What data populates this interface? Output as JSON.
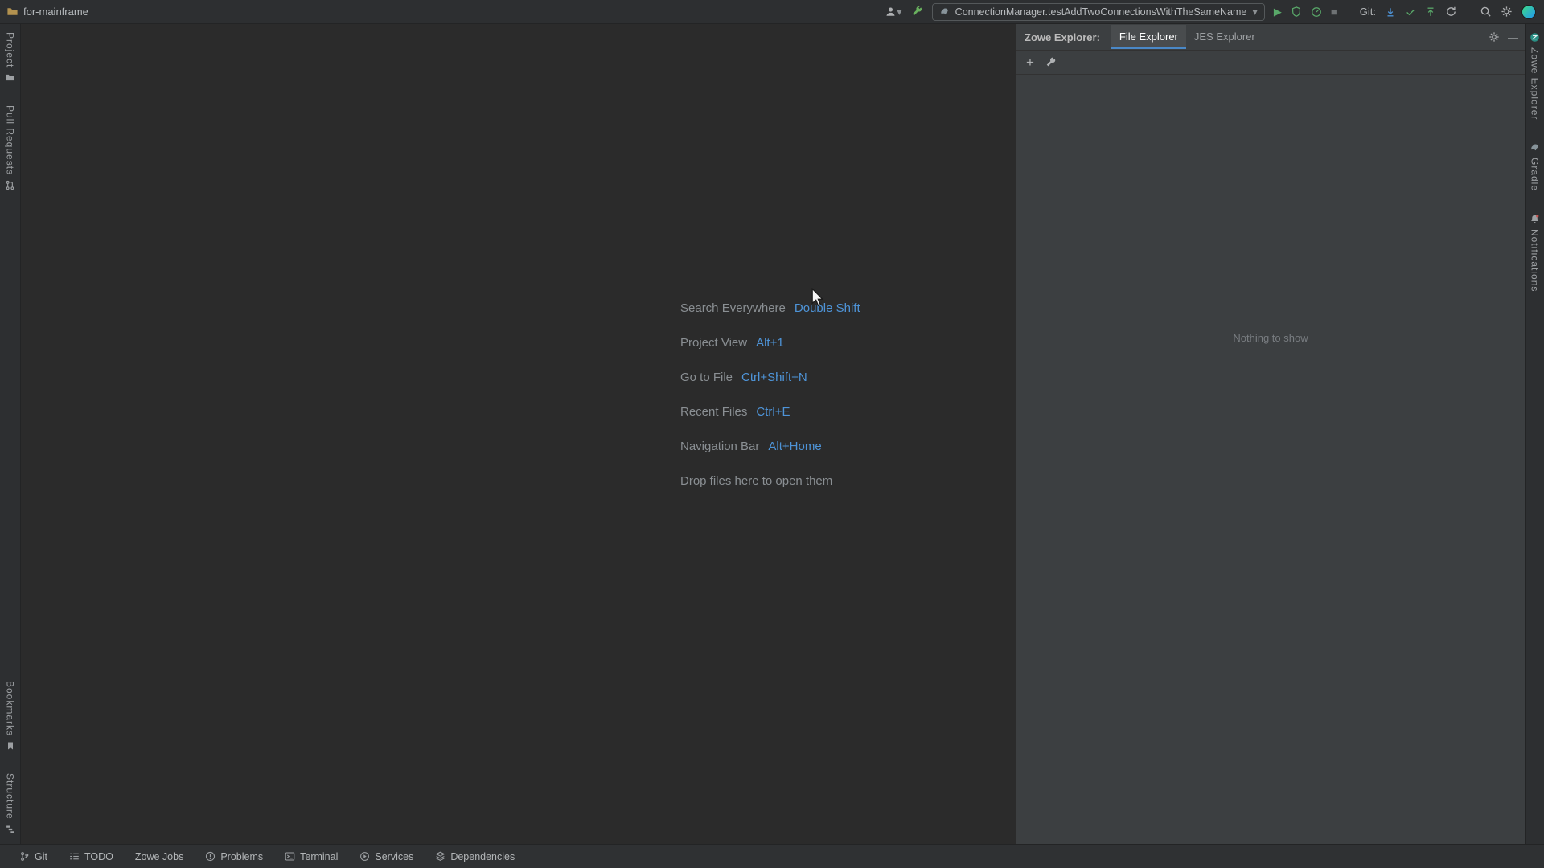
{
  "titlebar": {
    "project": "for-mainframe",
    "run_config": "ConnectionManager.testAddTwoConnectionsWithTheSameName",
    "git_label": "Git:"
  },
  "left_stripe": {
    "project": "Project",
    "pull_requests": "Pull Requests",
    "bookmarks": "Bookmarks",
    "structure": "Structure"
  },
  "editor": {
    "shortcuts": [
      {
        "label": "Search Everywhere",
        "keys": "Double Shift"
      },
      {
        "label": "Project View",
        "keys": "Alt+1"
      },
      {
        "label": "Go to File",
        "keys": "Ctrl+Shift+N"
      },
      {
        "label": "Recent Files",
        "keys": "Ctrl+E"
      },
      {
        "label": "Navigation Bar",
        "keys": "Alt+Home"
      }
    ],
    "drop_hint": "Drop files here to open them"
  },
  "zowe": {
    "title": "Zowe Explorer:",
    "tab_file": "File Explorer",
    "tab_jes": "JES Explorer",
    "empty": "Nothing to show"
  },
  "right_stripe": {
    "zowe": "Zowe Explorer",
    "gradle": "Gradle",
    "notifications": "Notifications"
  },
  "statusbar": {
    "items": [
      "Git",
      "TODO",
      "Zowe Jobs",
      "Problems",
      "Terminal",
      "Services",
      "Dependencies"
    ]
  },
  "icons": {
    "play": "▶",
    "stop": "■",
    "chevron_down": "▾",
    "add": "+",
    "minimize": "—"
  },
  "colors": {
    "accent_blue": "#4e94d8",
    "run_green": "#59A869",
    "panel_bg": "#3c3f41",
    "editor_bg": "#2b2b2b"
  }
}
